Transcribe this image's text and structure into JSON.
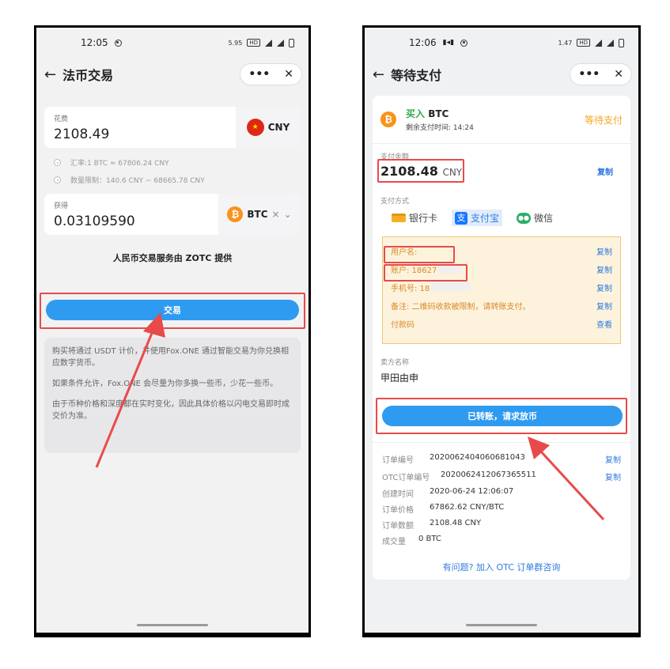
{
  "left": {
    "status": {
      "time": "12:05",
      "speed": "5.95"
    },
    "nav": {
      "title": "法币交易",
      "more": "•••",
      "close": "✕",
      "back": "←"
    },
    "spend": {
      "label": "花费",
      "value": "2108.49",
      "currency": "CNY"
    },
    "rate": "汇率:1 BTC ≈ 67806.24 CNY",
    "limit": "数量限制：140.6 CNY ~ 68665.78 CNY",
    "receive": {
      "label": "获得",
      "value": "0.03109590",
      "currency": "BTC",
      "clear": "×",
      "chevron": "⌄"
    },
    "provider": "人民币交易服务由 ZOTC 提供",
    "trade_button": "交易",
    "notes": [
      "购买将通过 USDT 计价，并使用Fox.ONE 通过智能交易为你兑换相应数字货币。",
      "如果条件允许，Fox.ONE 会尽量为你多换一些币，少花一些币。",
      "由于币种价格和深度都在实时变化，因此具体价格以闪电交易即时成交价为准。"
    ]
  },
  "right": {
    "status": {
      "time": "12:06",
      "speed": "1.47"
    },
    "nav": {
      "title": "等待支付",
      "more": "•••",
      "close": "✕",
      "back": "←"
    },
    "order": {
      "title_prefix": "买入",
      "title_coin": "BTC",
      "remaining": "剩余支付时间: 14:24",
      "status": "等待支付"
    },
    "amount": {
      "label": "支付金额",
      "value": "2108.48",
      "currency": "CNY",
      "copy": "复制"
    },
    "method_label": "支付方式",
    "methods": [
      "银行卡",
      "支付宝",
      "微信"
    ],
    "details": [
      {
        "text": "用户名:",
        "action": "复制"
      },
      {
        "text": "账户: 18627",
        "action": "复制"
      },
      {
        "text": "手机号: 18",
        "action": "复制"
      },
      {
        "text": "备注: 二维码收款被限制，请转账支付。",
        "action": "复制"
      },
      {
        "text": "付款码",
        "action": "查看"
      }
    ],
    "seller": {
      "label": "卖方名称",
      "name": "甲田由申"
    },
    "confirm_button": "已转账，请求放币",
    "info": [
      {
        "k": "订单编号",
        "v": "2020062404060681043",
        "action": "复制"
      },
      {
        "k": "OTC订单编号",
        "v": "2020062412067365511",
        "action": "复制"
      },
      {
        "k": "创建时间",
        "v": "2020-06-24 12:06:07",
        "action": ""
      },
      {
        "k": "订单价格",
        "v": "67862.62 CNY/BTC",
        "action": ""
      },
      {
        "k": "订单数额",
        "v": "2108.48 CNY",
        "action": ""
      },
      {
        "k": "成交量",
        "v": "0 BTC",
        "action": ""
      }
    ],
    "help_link": "有问题? 加入 OTC 订单群咨询"
  },
  "colors": {
    "accent": "#2e9bf0",
    "annotation": "#e84a4a",
    "pending": "#f6a623",
    "link": "#2f7ae0"
  }
}
